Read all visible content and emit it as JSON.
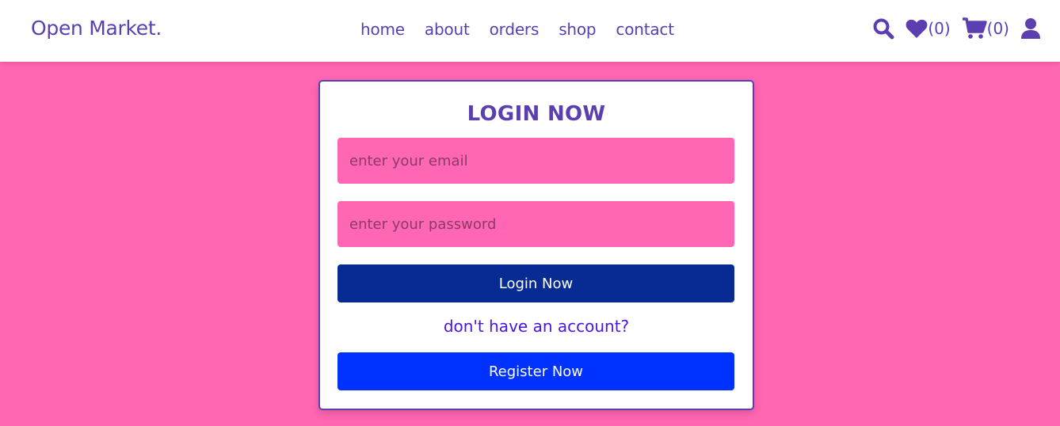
{
  "header": {
    "logo": "Open Market.",
    "nav": [
      "home",
      "about",
      "orders",
      "shop",
      "contact"
    ],
    "wishlist_count": "(0)",
    "cart_count": "(0)",
    "icons": [
      "search-icon",
      "heart-icon",
      "cart-icon",
      "user-icon"
    ]
  },
  "login_form": {
    "title": "LOGIN NOW",
    "email_placeholder": "enter your email",
    "email_value": "",
    "password_placeholder": "enter your password",
    "password_value": "",
    "login_button": "Login Now",
    "account_prompt": "don't have an account?",
    "register_button": "Register Now"
  },
  "colors": {
    "background": "#ff66b3",
    "brand_purple": "#5b3fb0",
    "login_button": "#072a93",
    "register_button": "#0032ff",
    "link": "#4a16e0"
  }
}
